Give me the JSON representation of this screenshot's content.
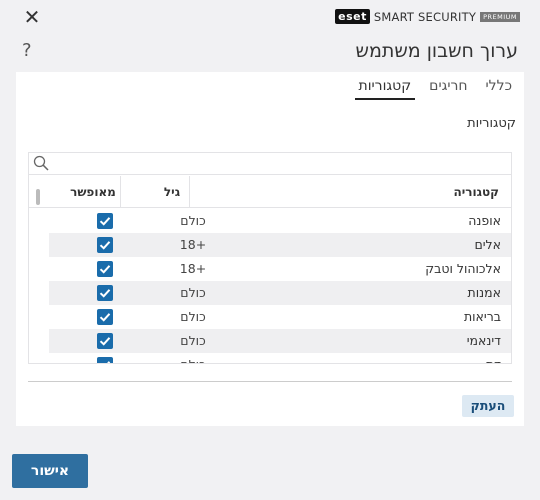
{
  "brand": {
    "logo": "eset",
    "name": "SMART SECURITY",
    "edition": "PREMIUM"
  },
  "window": {
    "close_icon": "close-icon",
    "close_glyph": "✕",
    "help_glyph": "?"
  },
  "page": {
    "title": "ערוך חשבון משתמש"
  },
  "tabs": [
    {
      "label": "כללי",
      "active": false
    },
    {
      "label": "חריגים",
      "active": false
    },
    {
      "label": "קטגוריות",
      "active": true
    }
  ],
  "section": {
    "title": "קטגוריות"
  },
  "table": {
    "search_placeholder": "",
    "headers": {
      "category": "קטגוריה",
      "age": "גיל",
      "allowed": "מאופשר"
    },
    "rows": [
      {
        "category": "אופנה",
        "age": "כולם",
        "allowed": true
      },
      {
        "category": "אלים",
        "age": "+18",
        "allowed": true
      },
      {
        "category": "אלכוהול וטבק",
        "age": "+18",
        "allowed": true
      },
      {
        "category": "אמנות",
        "age": "כולם",
        "allowed": true
      },
      {
        "category": "בריאות",
        "age": "כולם",
        "allowed": true
      },
      {
        "category": "דינאמי",
        "age": "כולם",
        "allowed": true
      },
      {
        "category": "דת",
        "age": "כולם",
        "allowed": true
      }
    ]
  },
  "buttons": {
    "copy": "העתק",
    "ok": "אישור"
  },
  "colors": {
    "accent": "#2f6fa0",
    "checkbox": "#1a6cab",
    "copy_bg": "#dde9f3"
  }
}
